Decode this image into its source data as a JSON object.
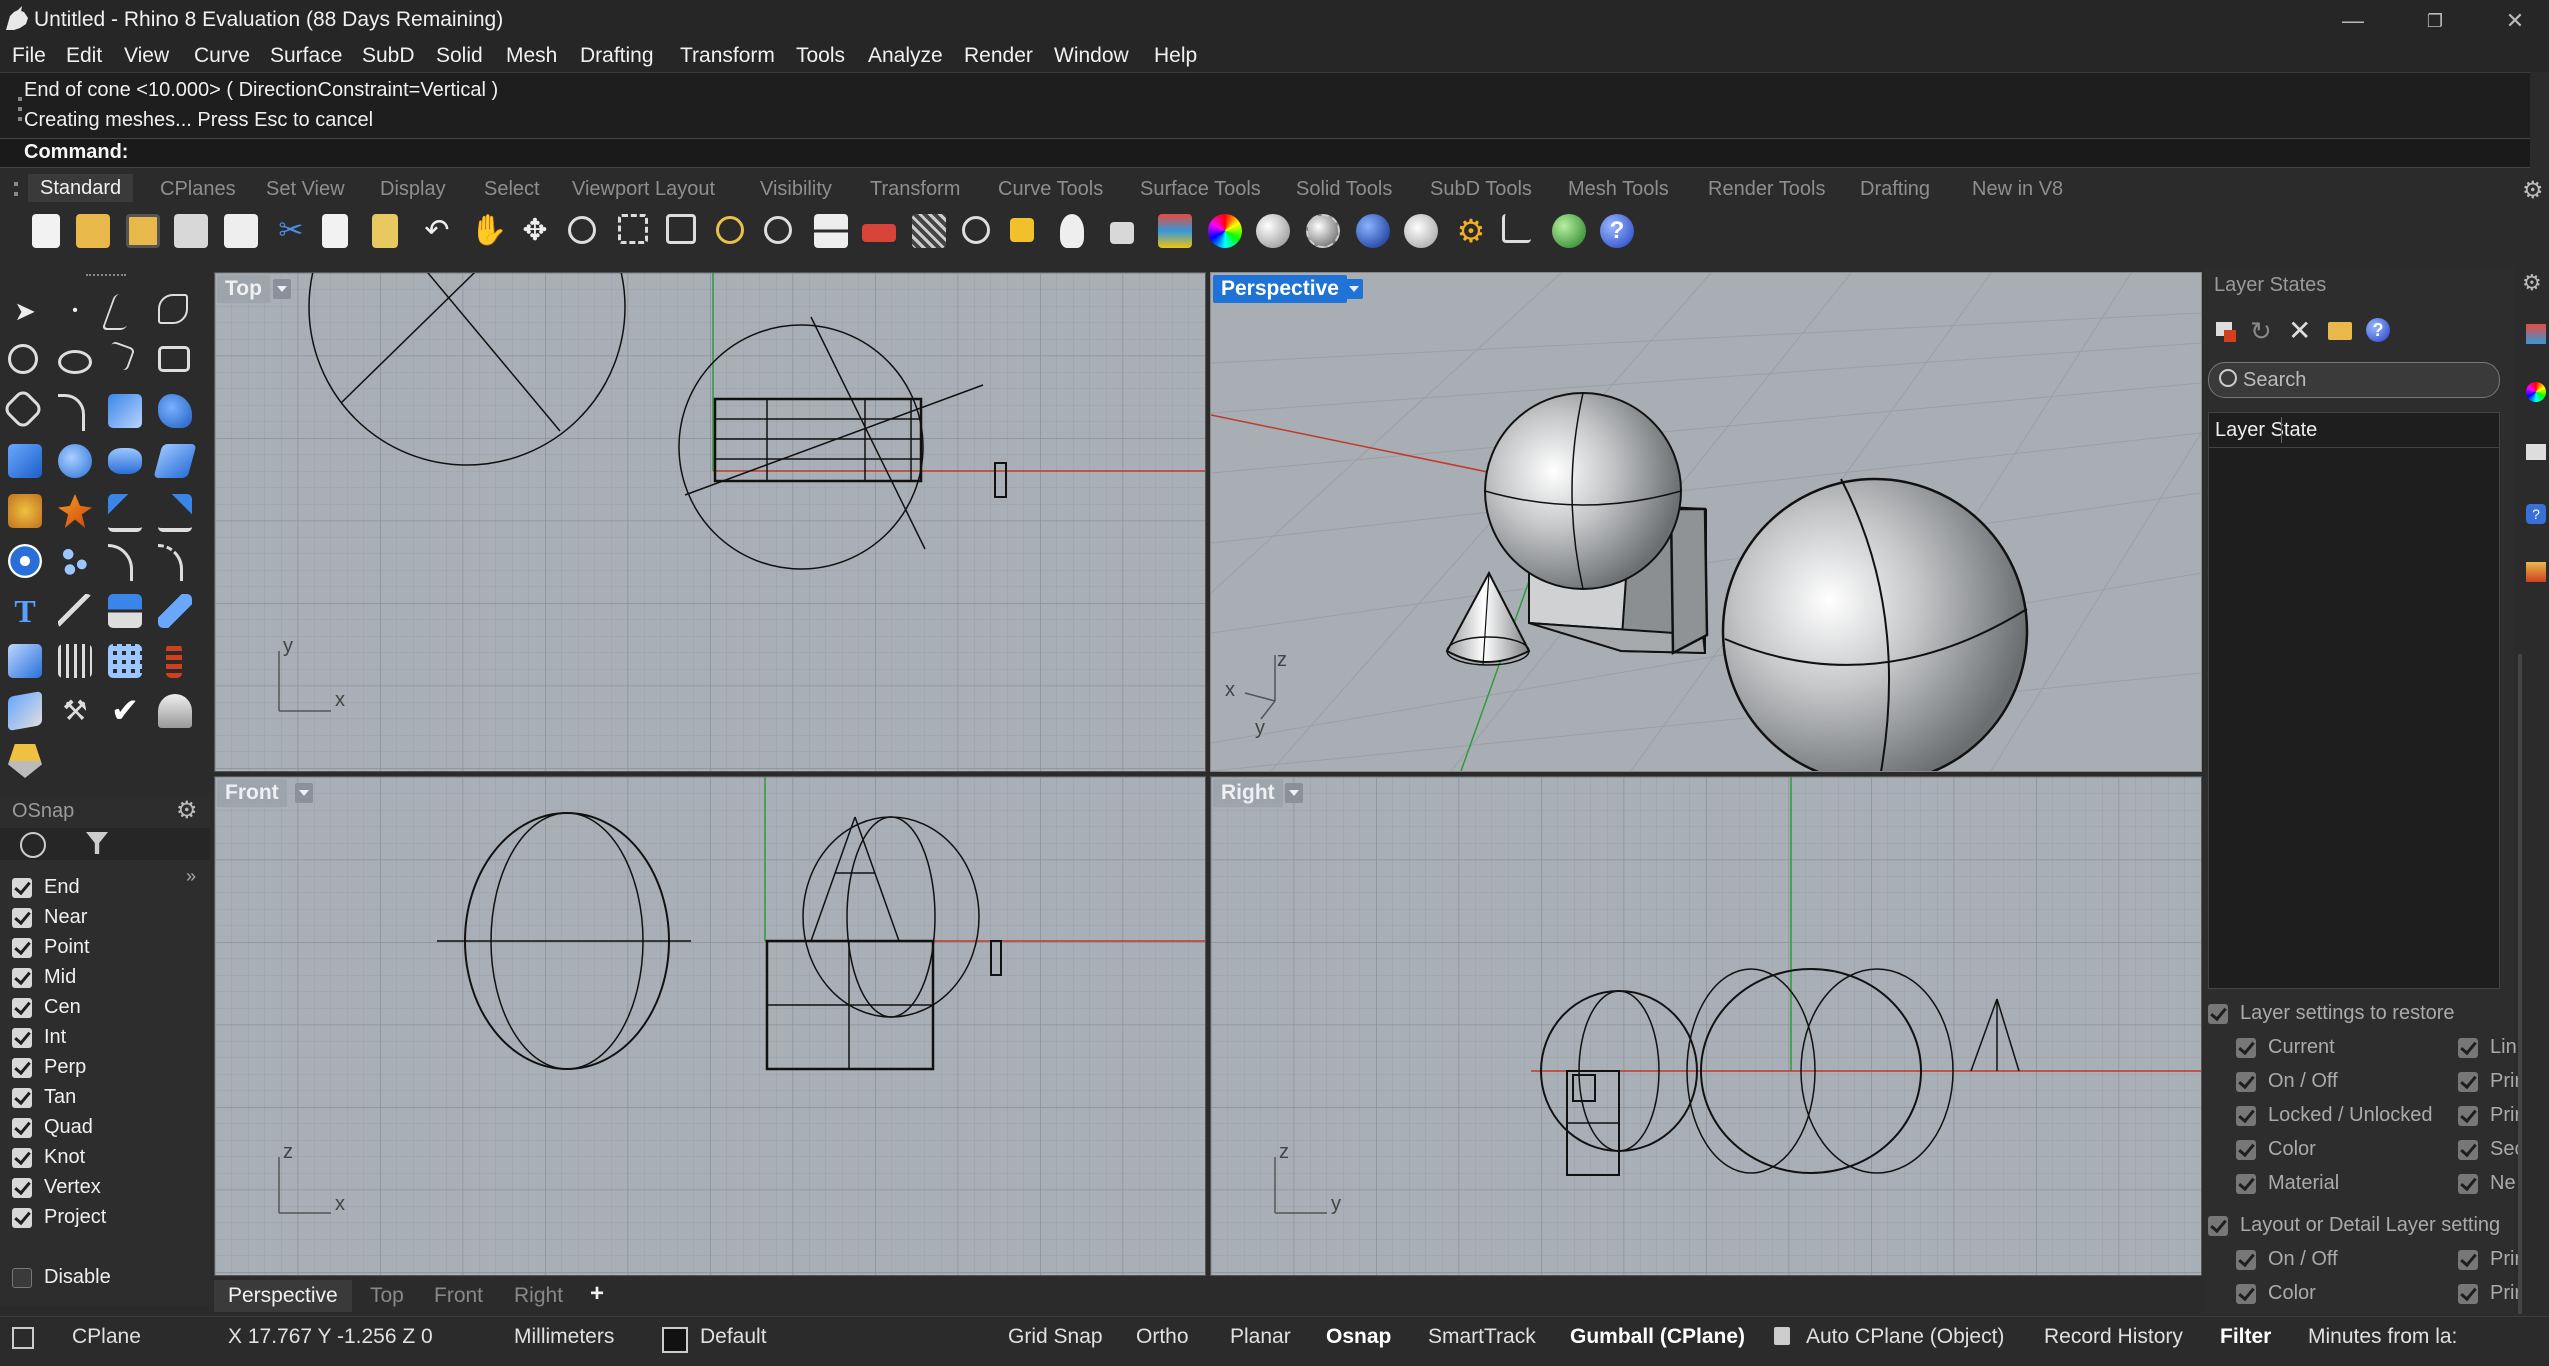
{
  "window": {
    "title": "Untitled - Rhino 8 Evaluation (88 Days Remaining)",
    "minimize": "—",
    "maximize": "❐",
    "close": "✕"
  },
  "menu": [
    "File",
    "Edit",
    "View",
    "Curve",
    "Surface",
    "SubD",
    "Solid",
    "Mesh",
    "Drafting",
    "Transform",
    "Tools",
    "Analyze",
    "Render",
    "Window",
    "Help"
  ],
  "command": {
    "history": [
      "End of cone <10.000> ( DirectionConstraint=Vertical )",
      "Creating meshes... Press Esc to cancel"
    ],
    "prompt": "Command:"
  },
  "toolbar_tabs": [
    "Standard",
    "CPlanes",
    "Set View",
    "Display",
    "Select",
    "Viewport Layout",
    "Visibility",
    "Transform",
    "Curve Tools",
    "Surface Tools",
    "Solid Tools",
    "SubD Tools",
    "Mesh Tools",
    "Render Tools",
    "Drafting",
    "New in V8"
  ],
  "toolbar_icons": [
    "new-icon",
    "open-icon",
    "save-icon",
    "print-icon",
    "import-icon",
    "cut-icon",
    "copy-icon",
    "paste-icon",
    "undo-icon",
    "pan-icon",
    "rotate-view-icon",
    "zoom-icon",
    "zoom-window-icon",
    "zoom-extents-icon",
    "zoom-selected-icon",
    "rotate-camera-icon",
    "viewport-layout-icon",
    "car-icon",
    "grid-icon",
    "osnap-icon",
    "properties-icon",
    "light-icon",
    "lock-icon",
    "layers-icon",
    "color-wheel-icon",
    "shaded-icon",
    "rendered-icon",
    "material-icon",
    "environment-icon",
    "settings-gear-icon",
    "dimension-icon",
    "globe-icon",
    "help-icon"
  ],
  "osnap": {
    "title": "OSnap",
    "items": [
      {
        "label": "End",
        "checked": true
      },
      {
        "label": "Near",
        "checked": true
      },
      {
        "label": "Point",
        "checked": true
      },
      {
        "label": "Mid",
        "checked": true
      },
      {
        "label": "Cen",
        "checked": true
      },
      {
        "label": "Int",
        "checked": true
      },
      {
        "label": "Perp",
        "checked": true
      },
      {
        "label": "Tan",
        "checked": true
      },
      {
        "label": "Quad",
        "checked": true
      },
      {
        "label": "Knot",
        "checked": true
      },
      {
        "label": "Vertex",
        "checked": true
      },
      {
        "label": "Project",
        "checked": true
      }
    ],
    "disable": "Disable"
  },
  "viewports": {
    "top": {
      "label": "Top",
      "axis_a": "y",
      "axis_b": "x"
    },
    "perspective": {
      "label": "Perspective",
      "axis_a": "z",
      "axis_b": "x",
      "axis_c": "y"
    },
    "front": {
      "label": "Front",
      "axis_a": "z",
      "axis_b": "x"
    },
    "right": {
      "label": "Right",
      "axis_a": "z",
      "axis_b": "y"
    }
  },
  "viewport_tabs": [
    "Perspective",
    "Top",
    "Front",
    "Right",
    "+"
  ],
  "layer_states": {
    "title": "Layer States",
    "search_placeholder": "Search",
    "column": "Layer State",
    "restore_header": "Layer settings to restore",
    "restore_left": [
      "Current",
      "On / Off",
      "Locked / Unlocked",
      "Color",
      "Material"
    ],
    "restore_right": [
      "Lin",
      "Prir",
      "Prir",
      "Sec",
      "Ne"
    ],
    "layout_header": "Layout or Detail Layer setting",
    "layout_left": [
      "On / Off",
      "Color"
    ],
    "layout_right": [
      "Prir",
      "Prir"
    ]
  },
  "status": {
    "cplane": "CPlane",
    "coords": "X 17.767 Y -1.256 Z 0",
    "units": "Millimeters",
    "layer": "Default",
    "grid_snap": "Grid Snap",
    "ortho": "Ortho",
    "planar": "Planar",
    "osnap": "Osnap",
    "smarttrack": "SmartTrack",
    "gumball": "Gumball (CPlane)",
    "auto_cplane": "Auto CPlane (Object)",
    "record_history": "Record History",
    "filter": "Filter",
    "minutes": "Minutes from la:"
  },
  "colors": {
    "viewport_bg": "#a9afb6",
    "active_label": "#1f72d6",
    "x_axis": "#c0392b",
    "y_axis": "#2e9c3a"
  }
}
